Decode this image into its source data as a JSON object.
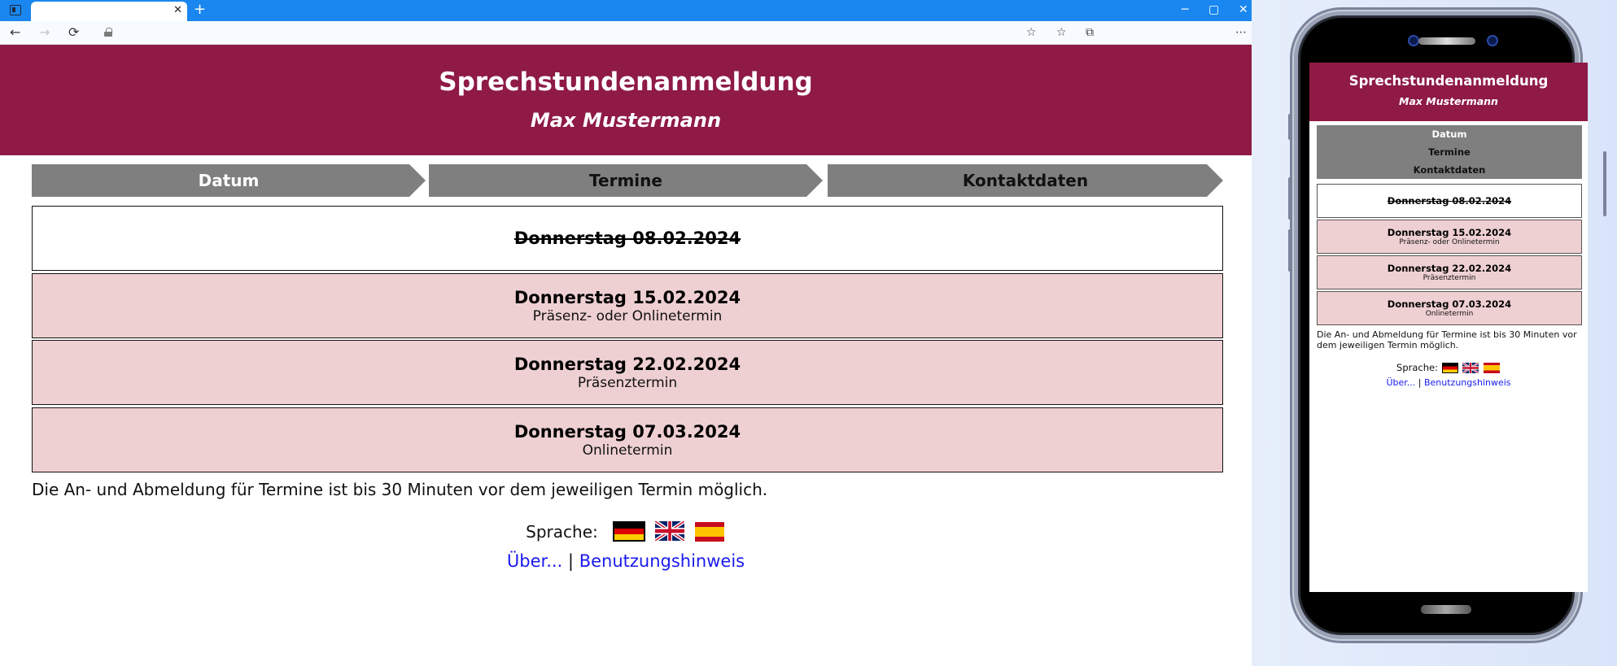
{
  "browser": {
    "tab_close_glyph": "✕",
    "new_tab_glyph": "+",
    "window_controls": {
      "minimize": "─",
      "maximize": "▢",
      "close": "✕"
    },
    "nav": {
      "back": "←",
      "forward": "→",
      "reload": "⟳"
    },
    "toolbar_icons": {
      "add_favorite": "☆",
      "favorites": "☆",
      "collections": "⧉",
      "more": "⋯"
    }
  },
  "header": {
    "title": "Sprechstundenanmeldung",
    "subtitle": "Max Mustermann"
  },
  "steps": [
    {
      "label": "Datum",
      "active": true
    },
    {
      "label": "Termine",
      "active": false
    },
    {
      "label": "Kontaktdaten",
      "active": false
    }
  ],
  "dates": [
    {
      "title": "Donnerstag 08.02.2024",
      "subtitle": "",
      "status": "past"
    },
    {
      "title": "Donnerstag 15.02.2024",
      "subtitle": "Präsenz- oder Onlinetermin",
      "status": "open"
    },
    {
      "title": "Donnerstag 22.02.2024",
      "subtitle": "Präsenztermin",
      "status": "open"
    },
    {
      "title": "Donnerstag 07.03.2024",
      "subtitle": "Onlinetermin",
      "status": "open"
    }
  ],
  "notice": "Die An- und Abmeldung für Termine ist bis 30 Minuten vor dem jeweiligen Termin möglich.",
  "language": {
    "label": "Sprache:",
    "flags": [
      "de-flag-icon",
      "uk-flag-icon",
      "es-flag-icon"
    ]
  },
  "links": {
    "about": "Über...",
    "separator": "|",
    "usage": "Benutzungshinweis"
  },
  "colors": {
    "brand": "#8e1a45",
    "step_bg": "#7f7f7f",
    "open_date_bg": "#efd0d2",
    "link": "#1a1aee"
  }
}
